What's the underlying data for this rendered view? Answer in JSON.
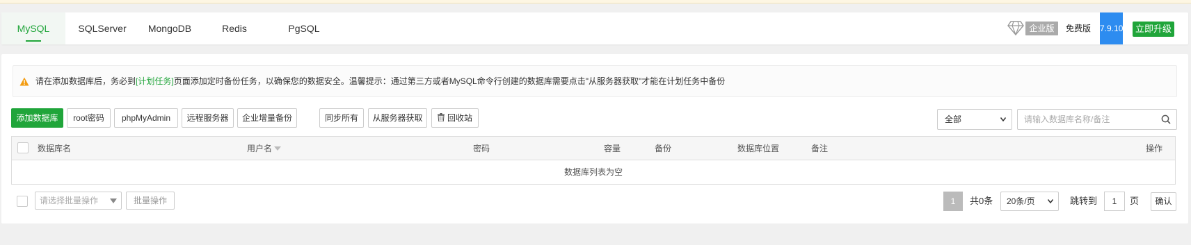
{
  "tabs": [
    {
      "label": "MySQL",
      "active": true
    },
    {
      "label": "SQLServer",
      "active": false
    },
    {
      "label": "MongoDB",
      "active": false
    },
    {
      "label": "Redis",
      "active": false
    },
    {
      "label": "PgSQL",
      "active": false
    }
  ],
  "header": {
    "enterprise_label": "企业版",
    "free_label": "免费版",
    "version": "7.9.10",
    "upgrade_label": "立即升级"
  },
  "alert": {
    "text_before_link": "请在添加数据库后，务必到",
    "link_text": "[计划任务]",
    "text_after_link": "页面添加定时备份任务，以确保您的数据安全。温馨提示：通过第三方或者MySQL命令行创建的数据库需要点击\"从服务器获取\"才能在计划任务中备份"
  },
  "toolbar": {
    "add_db": "添加数据库",
    "root_pwd": "root密码",
    "phpmyadmin": "phpMyAdmin",
    "remote_server": "远程服务器",
    "enterprise_backup": "企业增量备份",
    "sync_all": "同步所有",
    "fetch_from_server": "从服务器获取",
    "recycle_bin": "回收站"
  },
  "filter": {
    "selected": "全部",
    "search_placeholder": "请输入数据库名称/备注"
  },
  "table": {
    "columns": {
      "name": "数据库名",
      "user": "用户名",
      "password": "密码",
      "capacity": "容量",
      "backup": "备份",
      "location": "数据库位置",
      "note": "备注",
      "action": "操作"
    },
    "empty_text": "数据库列表为空"
  },
  "footer": {
    "batch_placeholder": "请选择批量操作",
    "batch_button": "批量操作"
  },
  "pagination": {
    "current_page": "1",
    "total": "共0条",
    "page_size": "20条/页",
    "jump_label": "跳转到",
    "jump_value": "1",
    "page_unit": "页",
    "confirm": "确认"
  },
  "colors": {
    "brand_green": "#20a53a",
    "version_blue": "#2d8cf0",
    "warning_orange": "#f39c12"
  }
}
